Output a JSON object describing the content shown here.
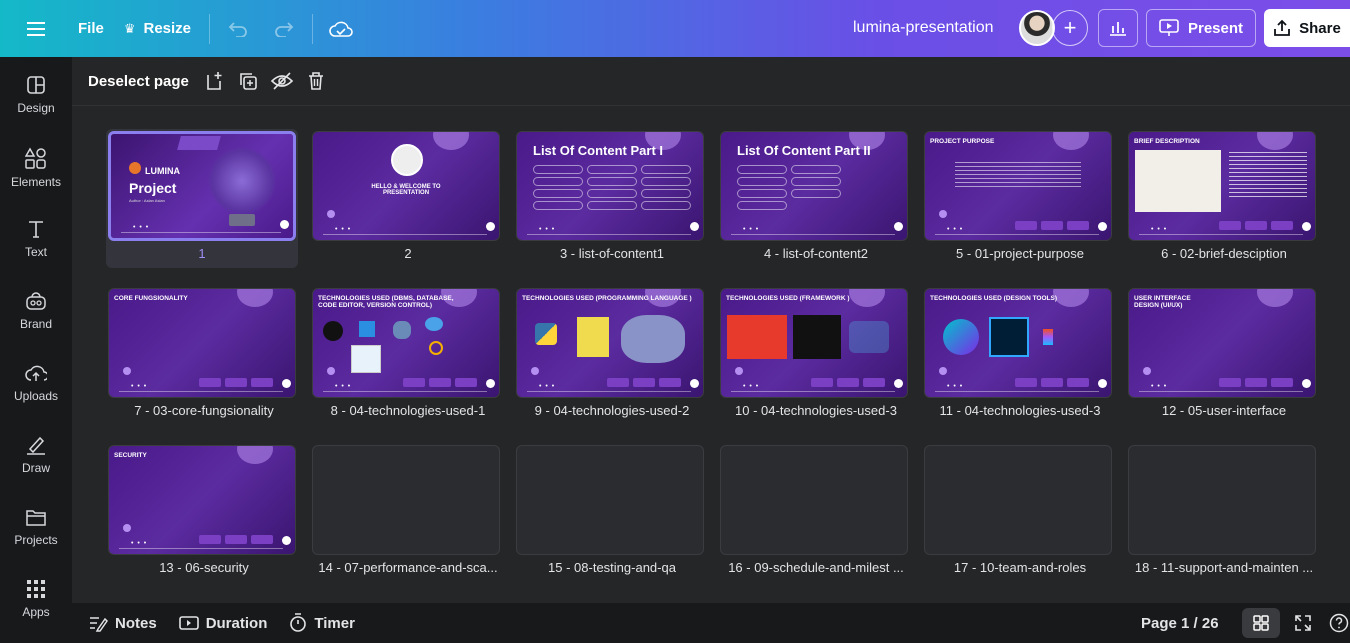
{
  "topbar": {
    "file_label": "File",
    "resize_label": "Resize",
    "doc_title": "lumina-presentation",
    "present_label": "Present",
    "share_label": "Share"
  },
  "sidebar": {
    "items": [
      {
        "label": "Design",
        "icon": "design-icon"
      },
      {
        "label": "Elements",
        "icon": "elements-icon"
      },
      {
        "label": "Text",
        "icon": "text-icon"
      },
      {
        "label": "Brand",
        "icon": "brand-icon"
      },
      {
        "label": "Uploads",
        "icon": "uploads-icon"
      },
      {
        "label": "Draw",
        "icon": "draw-icon"
      },
      {
        "label": "Projects",
        "icon": "projects-icon"
      },
      {
        "label": "Apps",
        "icon": "apps-icon"
      }
    ]
  },
  "subbar": {
    "deselect_label": "Deselect page"
  },
  "pages": [
    {
      "label": "1"
    },
    {
      "label": "2",
      "title": "HELLO & WELCOME TO PRESENTATION"
    },
    {
      "label": "3 - list-of-content1",
      "title": "List Of Content Part I"
    },
    {
      "label": "4 - list-of-content2",
      "title": "List Of Content Part II"
    },
    {
      "label": "5 - 01-project-purpose",
      "title": "PROJECT PURPOSE"
    },
    {
      "label": "6 - 02-brief-desciption",
      "title": "BRIEF DESCRIPTION"
    },
    {
      "label": "7 - 03-core-fungsionality",
      "title": "CORE FUNGSIONALITY"
    },
    {
      "label": "8 - 04-technologies-used-1",
      "title": "TECHNOLOGIES USED (DBMS, DATABASE, CODE EDITOR, VERSION CONTROL)"
    },
    {
      "label": "9 - 04-technologies-used-2",
      "title": "TECHNOLOGIES USED (PROGRAMMING LANGUAGE )"
    },
    {
      "label": "10 - 04-technologies-used-3",
      "title": "TECHNOLOGIES USED (FRAMEWORK )"
    },
    {
      "label": "11 - 04-technologies-used-3",
      "title": "TECHNOLOGIES USED (DESIGN TOOLS)"
    },
    {
      "label": "12 - 05-user-interface",
      "title": "USER INTERFACE DESIGN (UI/UX)"
    },
    {
      "label": "13 - 06-security",
      "title": "SECURITY"
    },
    {
      "label": "14 - 07-performance-and-sca..."
    },
    {
      "label": "15 - 08-testing-and-qa"
    },
    {
      "label": "16 - 09-schedule-and-milest ..."
    },
    {
      "label": "17 - 10-team-and-roles"
    },
    {
      "label": "18 - 11-support-and-mainten ..."
    }
  ],
  "slide1": {
    "brand": "LUMINA",
    "word": "Project",
    "author": "Author : Aslan Aslan"
  },
  "bottombar": {
    "notes_label": "Notes",
    "duration_label": "Duration",
    "timer_label": "Timer",
    "page_indicator": "Page 1 / 26"
  }
}
